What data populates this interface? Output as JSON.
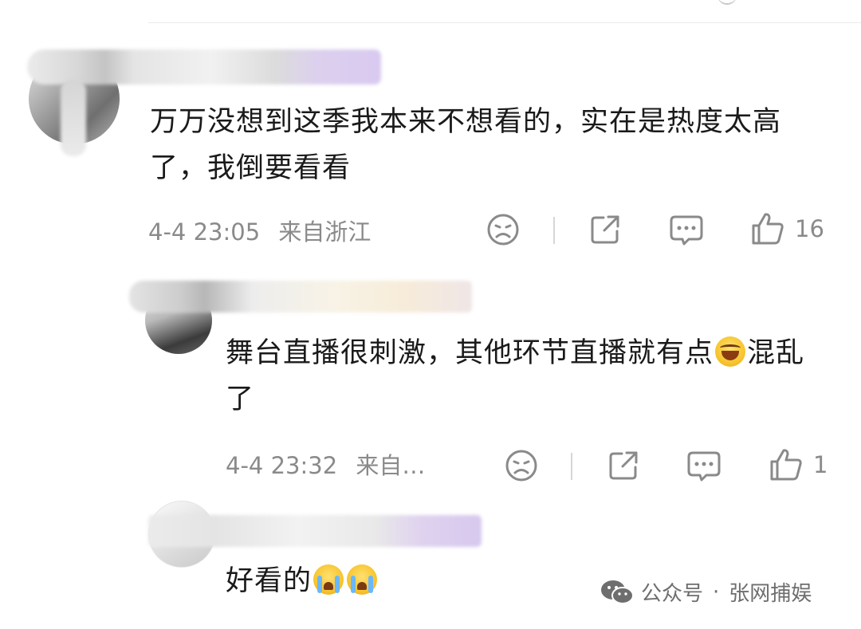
{
  "comments": [
    {
      "text": "万万没想到这季我本来不想看的，实在是热度太高了，我倒要看看",
      "time": "4-4 23:05",
      "location": "来自浙江",
      "likes": "16"
    },
    {
      "text_part1": "舞台直播很刺激，其他环节直播就有点",
      "emoji": "laughing-tears-emoji",
      "text_part2": "混乱了",
      "time": "4-4 23:32",
      "location": "来自…",
      "likes": "1"
    },
    {
      "text": "好看的",
      "emojis": [
        "crying-emoji",
        "crying-emoji"
      ]
    }
  ],
  "actions": {
    "icons": [
      "dislike-face-icon",
      "share-icon",
      "comment-icon",
      "thumbs-up-icon"
    ]
  },
  "watermark": {
    "icon": "wechat-icon",
    "label": "公众号",
    "separator": "·",
    "account": "张网捕娱"
  },
  "colors": {
    "text": "#1a1a1a",
    "meta": "#8a8a8a",
    "icon": "#8a8a8a",
    "divider": "#ececec"
  }
}
